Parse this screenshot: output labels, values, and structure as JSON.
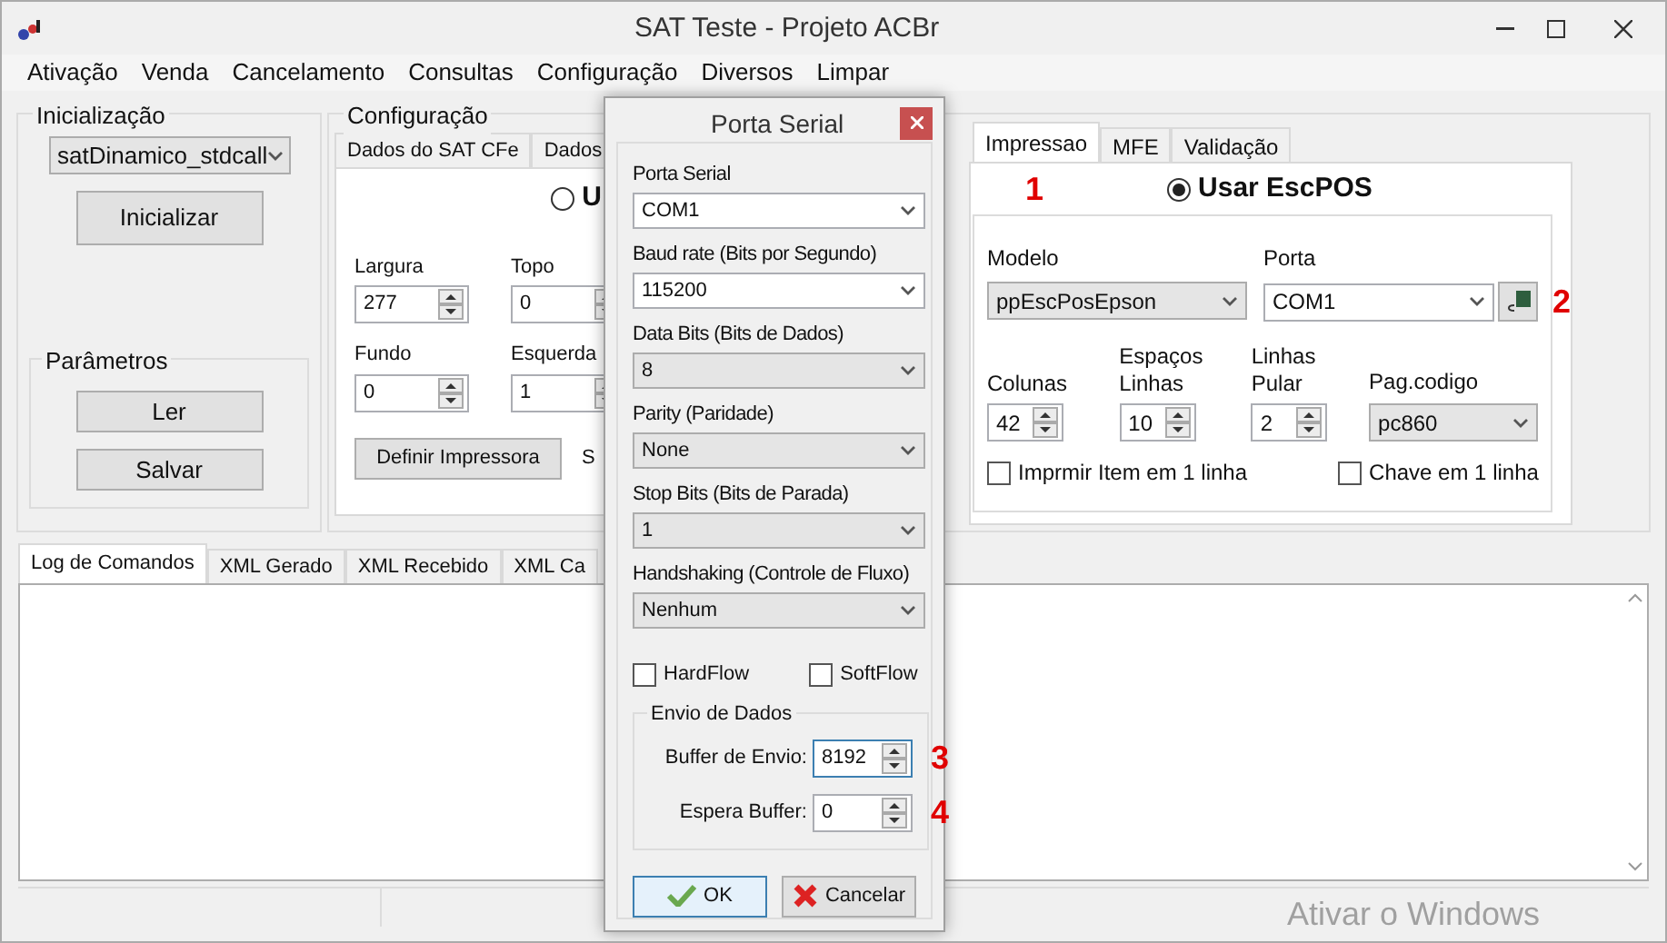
{
  "window": {
    "title": "SAT Teste - Projeto ACBr"
  },
  "menu": [
    "Ativação",
    "Venda",
    "Cancelamento",
    "Consultas",
    "Configuração",
    "Diversos",
    "Limpar"
  ],
  "inicializacao": {
    "title": "Inicialização",
    "library": "satDinamico_stdcall",
    "button": "Inicializar",
    "parametros": {
      "title": "Parâmetros",
      "buttons": [
        "Ler",
        "Salvar"
      ]
    }
  },
  "configuracao": {
    "title": "Configuração",
    "left_tabs": [
      {
        "label": "Dados do SAT CFe",
        "selected": false
      },
      {
        "label": "Dados",
        "selected": false
      }
    ],
    "left_page": {
      "radio": {
        "label": "U",
        "selected": false
      },
      "fields": [
        {
          "label": "Largura",
          "value": "277"
        },
        {
          "label": "Topo",
          "value": "0"
        },
        {
          "label": "Fundo",
          "value": "0"
        },
        {
          "label": "Esquerda",
          "value": "1"
        }
      ],
      "button": "Definir Impressora",
      "text": "S"
    },
    "right_tabs": [
      {
        "label": "Impressao",
        "selected": true
      },
      {
        "label": "MFE",
        "selected": false
      },
      {
        "label": "Validação",
        "selected": false
      }
    ],
    "right_page": {
      "radio": {
        "label": "Usar EscPOS",
        "selected": true
      },
      "modelo": {
        "label": "Modelo",
        "value": "ppEscPosEpson",
        "editable": false
      },
      "porta": {
        "label": "Porta",
        "value": "COM1",
        "editable": true
      },
      "spins": [
        {
          "label": "Colunas",
          "value": "42"
        },
        {
          "label": "Espaços Linhas",
          "value": "10"
        },
        {
          "label": "Linhas Pular",
          "value": "2"
        }
      ],
      "pagina_codigo": {
        "label": "Pag.codigo",
        "value": "pc860",
        "editable": false
      },
      "checks": [
        {
          "label": "Imprmir Item em 1 linha",
          "checked": false
        },
        {
          "label": "Chave em 1 linha",
          "checked": false
        }
      ]
    }
  },
  "log": {
    "tabs": [
      {
        "label": "Log de Comandos",
        "selected": true
      },
      {
        "label": "XML Gerado",
        "selected": false
      },
      {
        "label": "XML Recebido",
        "selected": false
      },
      {
        "label": "XML Ca",
        "selected": false
      }
    ]
  },
  "dialog": {
    "title": "Porta Serial",
    "fields": [
      {
        "label": "Porta Serial",
        "value": "COM1",
        "editable": true
      },
      {
        "label": "Baud rate (Bits por Segundo)",
        "value": "115200",
        "editable": true
      },
      {
        "label": "Data Bits (Bits de Dados)",
        "value": "8",
        "editable": false
      },
      {
        "label": "Parity (Paridade)",
        "value": "None",
        "editable": false
      },
      {
        "label": "Stop Bits (Bits de Parada)",
        "value": "1",
        "editable": false
      },
      {
        "label": "Handshaking (Controle de Fluxo)",
        "value": "Nenhum",
        "editable": false
      }
    ],
    "checks": [
      {
        "label": "HardFlow",
        "checked": false
      },
      {
        "label": "SoftFlow",
        "checked": false
      }
    ],
    "group": {
      "title": "Envio de Dados",
      "spins": [
        {
          "label": "Buffer de Envio:",
          "value": "8192",
          "focused": true,
          "annotation": "3"
        },
        {
          "label": "Espera Buffer:",
          "value": "0",
          "focused": false,
          "annotation": "4"
        }
      ]
    },
    "buttons": [
      {
        "label": "OK",
        "kind": "ok"
      },
      {
        "label": "Cancelar",
        "kind": "cancel"
      }
    ]
  },
  "annotations": [
    "1",
    "2"
  ],
  "watermark": "Ativar o Windows"
}
